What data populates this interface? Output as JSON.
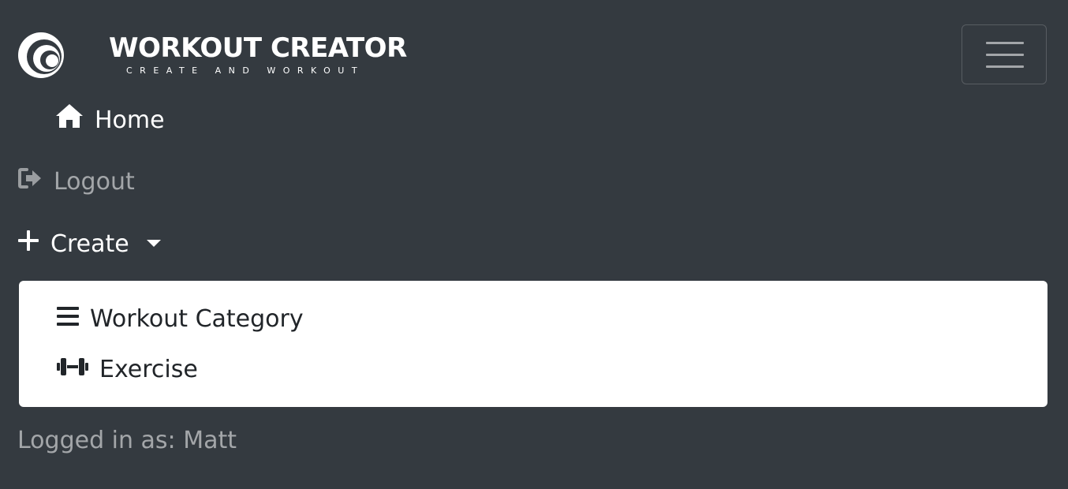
{
  "brand": {
    "title": "WORKOUT CREATOR",
    "tagline": "CREATE AND WORKOUT",
    "logo_icon": "crescent-swirl-logo"
  },
  "navbar": {
    "toggler_icon": "hamburger-icon",
    "items": [
      {
        "label": "Home",
        "icon": "home-icon"
      },
      {
        "label": "Logout",
        "icon": "sign-out-icon"
      },
      {
        "label": "Create",
        "icon": "plus-icon",
        "dropdown": true
      }
    ]
  },
  "dropdown": {
    "items": [
      {
        "label": "Workout Category",
        "icon": "bars-icon"
      },
      {
        "label": "Exercise",
        "icon": "dumbbell-icon"
      }
    ]
  },
  "status": {
    "logged_in_text": "Logged in as: Matt"
  },
  "colors": {
    "navbar_bg": "#343a40",
    "text_active": "#ffffff",
    "text_muted": "#9a9da0",
    "dropdown_bg": "#ffffff",
    "dropdown_text": "#212529"
  }
}
